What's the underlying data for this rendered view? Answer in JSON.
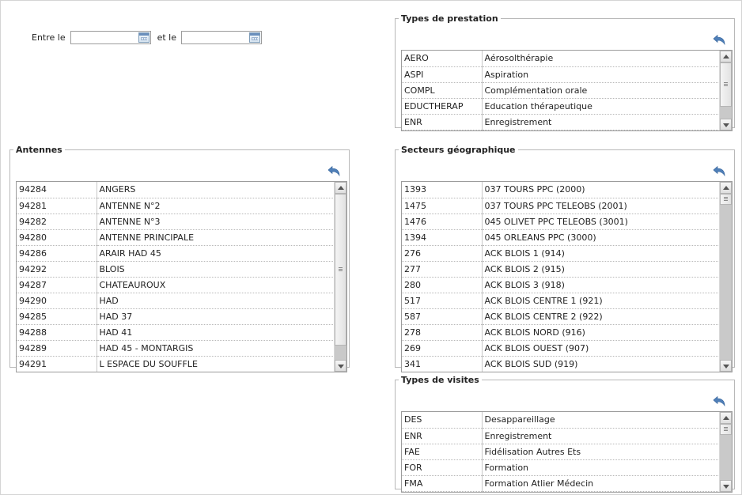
{
  "filters": {
    "from_label": "Entre le",
    "to_label": "et le",
    "from_value": "",
    "to_value": ""
  },
  "panels": {
    "prestation": {
      "title": "Types de prestation",
      "rows": [
        [
          "AERO",
          "Aérosolthérapie"
        ],
        [
          "ASPI",
          "Aspiration"
        ],
        [
          "COMPL",
          "Complémentation orale"
        ],
        [
          "EDUCTHERAP",
          "Education thérapeutique"
        ],
        [
          "ENR",
          "Enregistrement"
        ]
      ]
    },
    "antennes": {
      "title": "Antennes",
      "rows": [
        [
          "94284",
          "ANGERS"
        ],
        [
          "94281",
          "ANTENNE N°2"
        ],
        [
          "94282",
          "ANTENNE N°3"
        ],
        [
          "94280",
          "ANTENNE PRINCIPALE"
        ],
        [
          "94286",
          "ARAIR HAD 45"
        ],
        [
          "94292",
          "BLOIS"
        ],
        [
          "94287",
          "CHATEAUROUX"
        ],
        [
          "94290",
          "HAD"
        ],
        [
          "94285",
          "HAD 37"
        ],
        [
          "94288",
          "HAD 41"
        ],
        [
          "94289",
          "HAD 45 - MONTARGIS"
        ],
        [
          "94291",
          "L ESPACE DU SOUFFLE"
        ]
      ]
    },
    "secteurs": {
      "title": "Secteurs géographique",
      "rows": [
        [
          "1393",
          "037 TOURS PPC (2000)"
        ],
        [
          "1475",
          "037 TOURS PPC TELEOBS (2001)"
        ],
        [
          "1476",
          "045 OLIVET PPC TELEOBS (3001)"
        ],
        [
          "1394",
          "045 ORLEANS PPC (3000)"
        ],
        [
          "276",
          "ACK BLOIS 1 (914)"
        ],
        [
          "277",
          "ACK BLOIS 2 (915)"
        ],
        [
          "280",
          "ACK BLOIS 3 (918)"
        ],
        [
          "517",
          "ACK BLOIS CENTRE 1 (921)"
        ],
        [
          "587",
          "ACK BLOIS CENTRE 2 (922)"
        ],
        [
          "278",
          "ACK BLOIS NORD (916)"
        ],
        [
          "269",
          "ACK BLOIS OUEST (907)"
        ],
        [
          "341",
          "ACK BLOIS SUD (919)"
        ]
      ]
    },
    "visites": {
      "title": "Types de visites",
      "rows": [
        [
          "DES",
          "Desappareillage"
        ],
        [
          "ENR",
          "Enregistrement"
        ],
        [
          "FAE",
          "Fidélisation Autres Ets"
        ],
        [
          "FOR",
          "Formation"
        ],
        [
          "FMA",
          "Formation Atlier Médecin"
        ]
      ]
    }
  },
  "icons": {
    "reset": "undo-arrow-icon",
    "calendar": "calendar-icon"
  },
  "colors": {
    "undo_arrow": "#4f7fb8",
    "border": "#b8b8b8"
  }
}
